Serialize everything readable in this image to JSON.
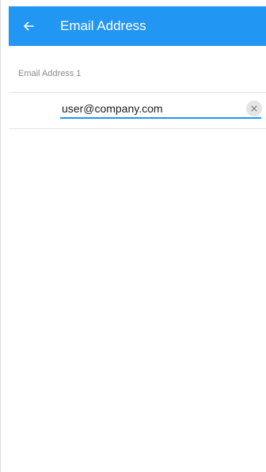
{
  "header": {
    "title": "Email Address",
    "back_icon": "arrow-left-icon",
    "background_color": "#2196f3"
  },
  "form": {
    "section_label": "Email Address 1",
    "email_value": "user@company.com",
    "clear_icon": "close-icon",
    "accent_color": "#2196f3"
  }
}
